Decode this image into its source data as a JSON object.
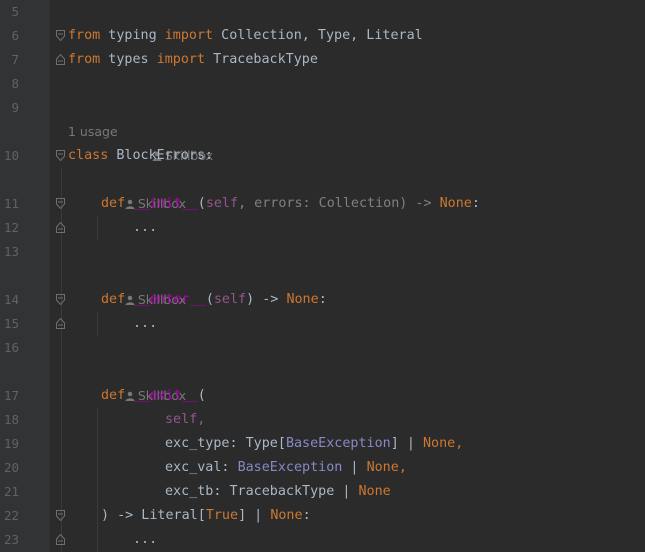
{
  "lines": {
    "l5": "5",
    "l6": "6",
    "l7": "7",
    "l8": "8",
    "l9": "9",
    "l10": "10",
    "l11": "11",
    "l12": "12",
    "l13": "13",
    "l14": "14",
    "l15": "15",
    "l16": "16",
    "l17": "17",
    "l18": "18",
    "l19": "19",
    "l20": "20",
    "l21": "21",
    "l22": "22",
    "l23": "23"
  },
  "code": {
    "from": "from",
    "import": "import",
    "typing": " typing ",
    "typing_names": " Collection, Type, Literal",
    "types": " types ",
    "types_names": " TracebackType",
    "class_kw": "class",
    "class_name": " BlockErrors:",
    "def": "def",
    "init": "__init__",
    "enter": "__enter__",
    "exit": "__exit__",
    "self": "self",
    "init_params": ", errors: Collection) -> ",
    "none": "None",
    "colon": ":",
    "ellipsis": "...",
    "open_paren": "(",
    "close_paren": ")",
    "enter_tail": ") -> ",
    "self_comma": "self,",
    "exc_type_pre": "exc_type: Type[",
    "base_exception": "BaseException",
    "exc_type_post": "] | ",
    "comma": ",",
    "exc_val_pre": "exc_val: ",
    "pipe": " | ",
    "exc_tb_pre": "exc_tb: TracebackType | ",
    "exit_tail_pre": ") -> Literal[",
    "true": "True",
    "exit_tail_post": "] | "
  },
  "hints": {
    "usage": "1 usage",
    "author": "Skillbox"
  },
  "icons": {
    "fold": "fold-marker-icon",
    "person": "user-icon"
  },
  "colors": {
    "background": "#2b2b2b",
    "keyword": "#cc7832",
    "dunder": "#b200b2",
    "self": "#94558d",
    "builtin_class": "#8888c6",
    "text": "#a9b7c6"
  }
}
